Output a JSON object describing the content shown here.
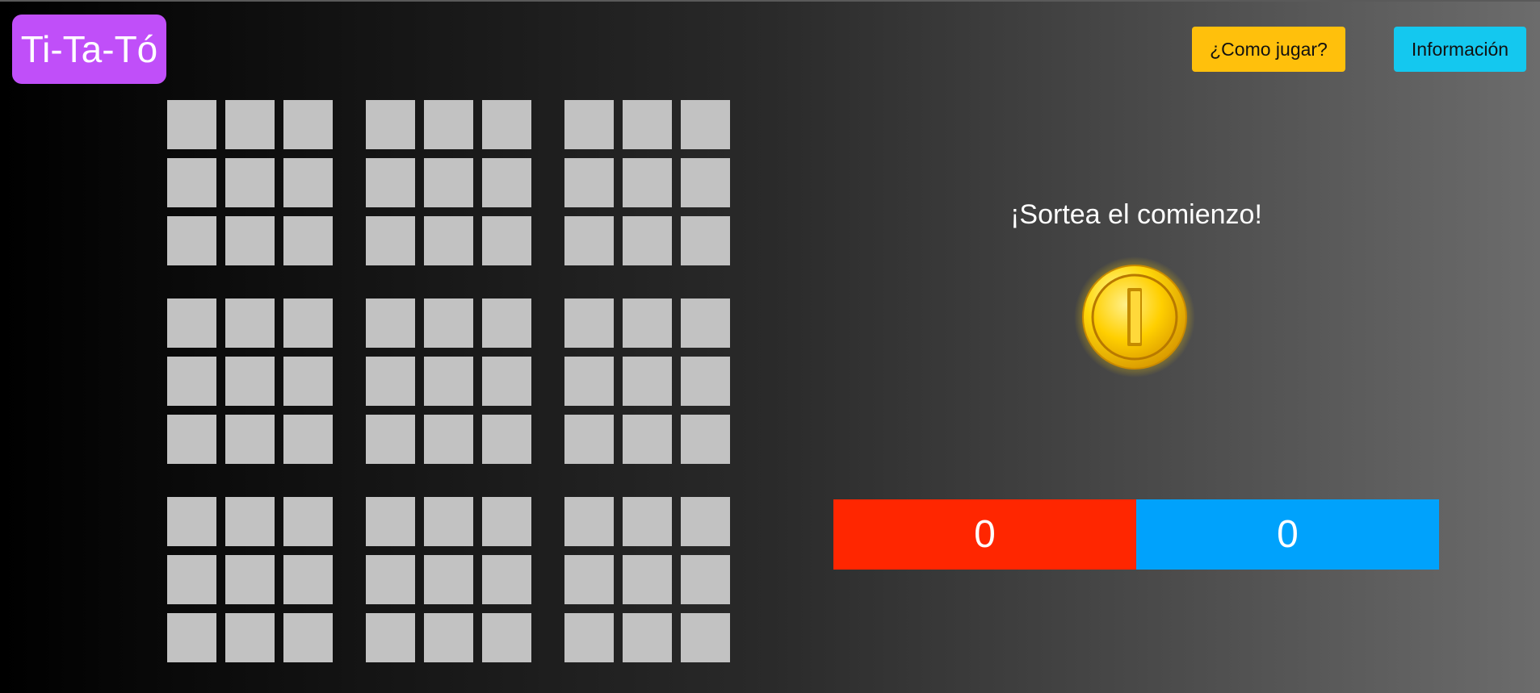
{
  "header": {
    "logo_text": "Ti-Ta-Tó",
    "how_to_play_label": "¿Como jugar?",
    "info_label": "Información"
  },
  "game": {
    "prompt": "¡Sortea el comienzo!",
    "coin_icon": "coin-icon",
    "board": {
      "rows": 3,
      "cols": 3,
      "cells_per_side": 3,
      "cell_state": "empty"
    }
  },
  "scores": {
    "red": "0",
    "blue": "0"
  },
  "colors": {
    "logo": "#c04ff9",
    "how_to_play_button": "#ffc00c",
    "info_button": "#14c8ef",
    "cell": "#c2c2c2",
    "score_red": "#ff2600",
    "score_blue": "#00a2fc",
    "coin": "#f4c400"
  }
}
